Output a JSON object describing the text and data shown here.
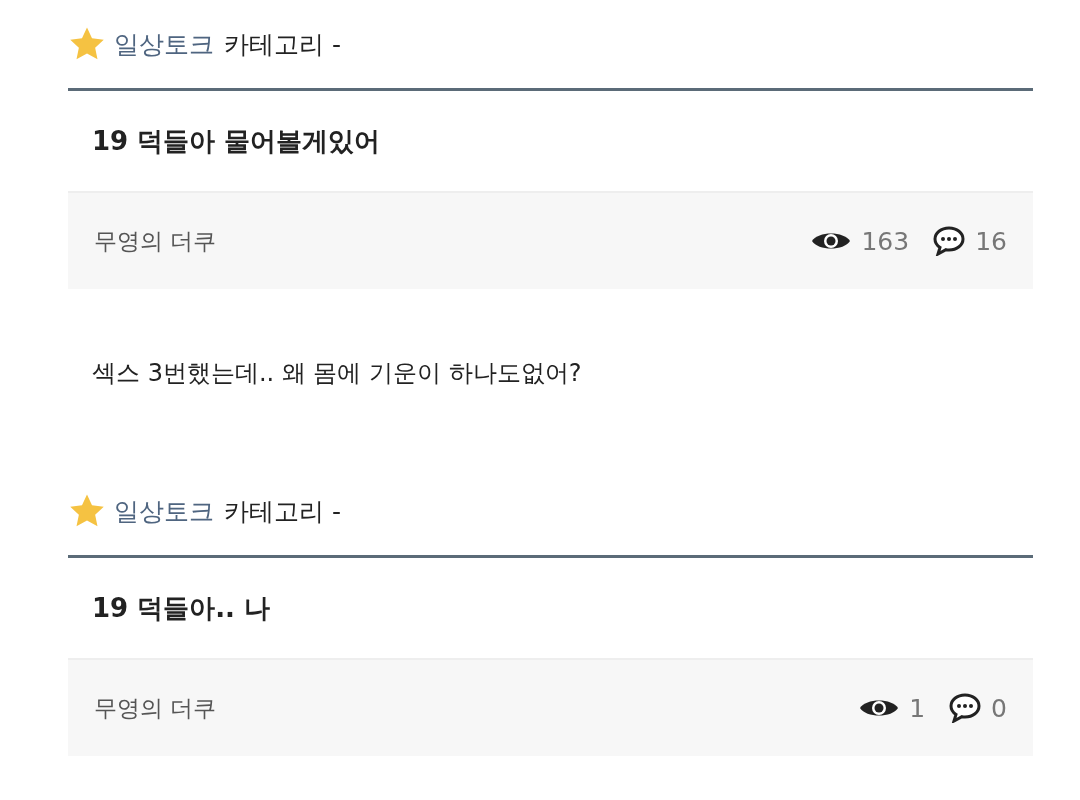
{
  "posts": [
    {
      "category": "일상토크",
      "category_suffix": "카테고리 -",
      "title": "19 덕들아 물어볼게있어",
      "author": "무영의 더쿠",
      "views": "163",
      "comments": "16",
      "body": "섹스 3번했는데.. 왜 몸에 기운이 하나도없어?"
    },
    {
      "category": "일상토크",
      "category_suffix": "카테고리 -",
      "title": "19 덕들아.. 나",
      "author": "무영의 더쿠",
      "views": "1",
      "comments": "0"
    }
  ]
}
